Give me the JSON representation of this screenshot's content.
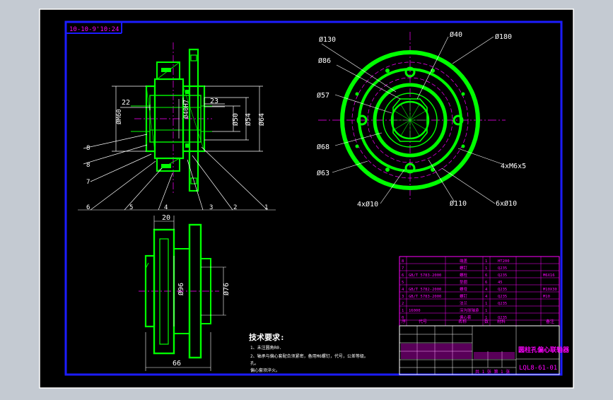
{
  "drawing": {
    "stamp": "10-10-9'10:24",
    "title": "圆柱孔偏心联轴器",
    "drawing_no": "LQL8-61-01",
    "sheet_info": "共 1 张  第 1 张"
  },
  "front_view": {
    "dims": {
      "d_m60": "ØM60",
      "d_22": "22",
      "d_23": "23",
      "d_40": "Ø40H7",
      "d_50": "Ø50",
      "d_54": "Ø54",
      "d_64": "Ø64"
    },
    "balloons": [
      "8",
      "8",
      "7",
      "6",
      "5",
      "4",
      "3",
      "2",
      "1"
    ]
  },
  "side_view": {
    "dims": {
      "d_130": "Ø130",
      "d_40": "Ø40",
      "d_180": "Ø180",
      "d_86": "Ø86",
      "d_57": "Ø57",
      "d_68": "Ø68",
      "d_63": "Ø63",
      "holes_small": "4xØ10",
      "d_110": "Ø110",
      "holes_large": "6xØ10",
      "tapped": "4xM6x5"
    }
  },
  "bottom_view": {
    "dims": {
      "d_20": "20",
      "d_96": "Ø96",
      "d_76": "Ø76",
      "d_66": "66"
    }
  },
  "notes": {
    "heading": "技术要求:",
    "lines": [
      "1、未注圆角R0.",
      "2、轴承与偏心套配合须紧密，备用M6螺钉，代号，公差等级。",
      "孔。",
      "     偏心套须淬火。"
    ]
  },
  "bom": {
    "rows": [
      {
        "no": "8",
        "code": "",
        "name": "端盖",
        "qty": "1",
        "mat": "HT200",
        "note": ""
      },
      {
        "no": "7",
        "code": "",
        "name": "螺钉",
        "qty": "1",
        "mat": "Q235",
        "note": ""
      },
      {
        "no": "6",
        "code": "GB/T 5783-2000",
        "name": "螺栓",
        "qty": "6",
        "mat": "Q235",
        "note": "M6X16"
      },
      {
        "no": "5",
        "code": "",
        "name": "垫圈",
        "qty": "6",
        "mat": "45",
        "note": ""
      },
      {
        "no": "4",
        "code": "GB/T 5782-2000",
        "name": "螺母",
        "qty": "4",
        "mat": "Q235",
        "note": "M10X30"
      },
      {
        "no": "3",
        "code": "GB/T 5783-2000",
        "name": "螺钉",
        "qty": "4",
        "mat": "Q235",
        "note": "M10"
      },
      {
        "no": "2",
        "code": "",
        "name": "法兰",
        "qty": "1",
        "mat": "Q235",
        "note": ""
      },
      {
        "no": "1",
        "code": "16000",
        "name": "深沟球轴承",
        "qty": "1",
        "mat": "",
        "note": ""
      },
      {
        "no": "0",
        "code": "",
        "name": "偏心套",
        "qty": "1",
        "mat": "Q235",
        "note": ""
      }
    ],
    "header": [
      "序",
      "代号",
      "名称",
      "数",
      "材料",
      "备注"
    ]
  }
}
